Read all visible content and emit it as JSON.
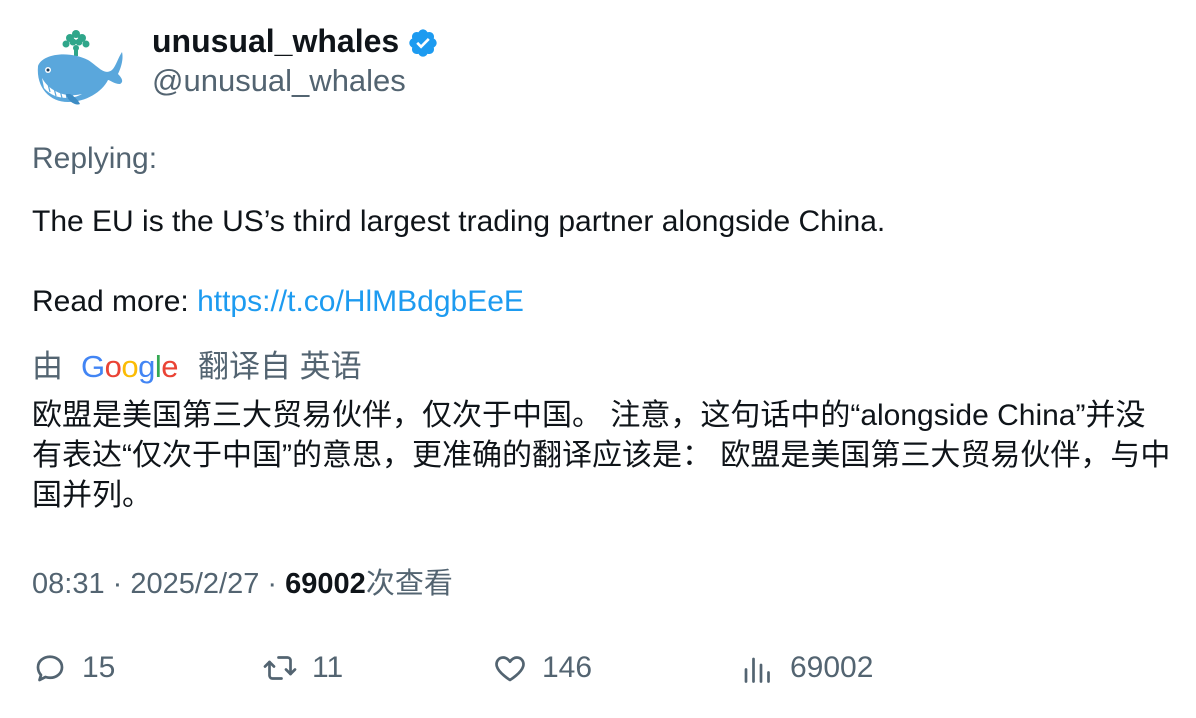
{
  "author": {
    "name": "unusual_whales",
    "handle": "@unusual_whales",
    "verified": true
  },
  "tweet": {
    "replying_label": "Replying:",
    "text_line1": "The EU is the US’s third largest trading partner alongside China.",
    "read_more_label": "Read more: ",
    "link": "https://t.co/HlMBdgbEeE"
  },
  "translation": {
    "by_label": "由",
    "translated_from_label": "翻译自 英语",
    "text": "欧盟是美国第三大贸易伙伴，仅次于中国。 注意，这句话中的“alongside China”并没有表达“仅次于中国”的意思，更准确的翻译应该是： 欧盟是美国第三大贸易伙伴，与中国并列。"
  },
  "meta": {
    "time": "08:31",
    "separator": " · ",
    "date": "2025/2/27",
    "views_count": "69002",
    "views_label": "次查看"
  },
  "actions": {
    "replies": "15",
    "retweets": "11",
    "likes": "146",
    "views": "69002"
  },
  "colors": {
    "link": "#1d9bf0",
    "muted": "#536471",
    "verified": "#1d9bf0"
  }
}
